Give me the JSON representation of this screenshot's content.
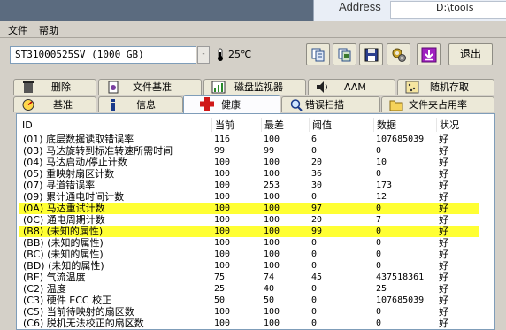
{
  "background_window": {
    "address_label": "Address",
    "path": "D:\\tools"
  },
  "menu": {
    "file": "文件",
    "help": "帮助"
  },
  "toolbar": {
    "drive": "ST31000525SV (1000 GB)",
    "drive_arrow": "-",
    "temperature": "25℃",
    "exit_label": "退出"
  },
  "tabs_top": [
    {
      "label": "删除",
      "icon": "trash-icon"
    },
    {
      "label": "文件基准",
      "icon": "file-benchmark-icon"
    },
    {
      "label": "磁盘监视器",
      "icon": "disk-monitor-icon"
    },
    {
      "label": "AAM",
      "icon": "speaker-icon"
    },
    {
      "label": "随机存取",
      "icon": "random-access-icon"
    }
  ],
  "tabs_bottom": [
    {
      "label": "基准",
      "icon": "benchmark-icon"
    },
    {
      "label": "信息",
      "icon": "info-icon"
    },
    {
      "label": "健康",
      "icon": "health-cross-icon"
    },
    {
      "label": "错误扫描",
      "icon": "error-scan-icon"
    },
    {
      "label": "文件夹占用率",
      "icon": "folder-icon"
    }
  ],
  "columns": [
    "ID",
    "当前",
    "最差",
    "阈值",
    "数据",
    "状况"
  ],
  "rows": [
    {
      "id": "(01) 底层数据读取错误率",
      "cur": "116",
      "wor": "100",
      "thr": "6",
      "dat": "107685039",
      "st": "好",
      "hl": false
    },
    {
      "id": "(03) 马达旋转到标准转速所需时间",
      "cur": "99",
      "wor": "99",
      "thr": "0",
      "dat": "0",
      "st": "好",
      "hl": false
    },
    {
      "id": "(04) 马达启动/停止计数",
      "cur": "100",
      "wor": "100",
      "thr": "20",
      "dat": "10",
      "st": "好",
      "hl": false
    },
    {
      "id": "(05) 重映射扇区计数",
      "cur": "100",
      "wor": "100",
      "thr": "36",
      "dat": "0",
      "st": "好",
      "hl": false
    },
    {
      "id": "(07) 寻道错误率",
      "cur": "100",
      "wor": "253",
      "thr": "30",
      "dat": "173",
      "st": "好",
      "hl": false
    },
    {
      "id": "(09) 累计通电时间计数",
      "cur": "100",
      "wor": "100",
      "thr": "0",
      "dat": "12",
      "st": "好",
      "hl": false
    },
    {
      "id": "(0A) 马达重试计数",
      "cur": "100",
      "wor": "100",
      "thr": "97",
      "dat": "0",
      "st": "好",
      "hl": true
    },
    {
      "id": "(0C) 通电周期计数",
      "cur": "100",
      "wor": "100",
      "thr": "20",
      "dat": "7",
      "st": "好",
      "hl": false
    },
    {
      "id": "(B8) (未知的属性)",
      "cur": "100",
      "wor": "100",
      "thr": "99",
      "dat": "0",
      "st": "好",
      "hl": true
    },
    {
      "id": "(BB) (未知的属性)",
      "cur": "100",
      "wor": "100",
      "thr": "0",
      "dat": "0",
      "st": "好",
      "hl": false
    },
    {
      "id": "(BC) (未知的属性)",
      "cur": "100",
      "wor": "100",
      "thr": "0",
      "dat": "0",
      "st": "好",
      "hl": false
    },
    {
      "id": "(BD) (未知的属性)",
      "cur": "100",
      "wor": "100",
      "thr": "0",
      "dat": "0",
      "st": "好",
      "hl": false
    },
    {
      "id": "(BE) 气流温度",
      "cur": "75",
      "wor": "74",
      "thr": "45",
      "dat": "437518361",
      "st": "好",
      "hl": false
    },
    {
      "id": "(C2) 温度",
      "cur": "25",
      "wor": "40",
      "thr": "0",
      "dat": "25",
      "st": "好",
      "hl": false
    },
    {
      "id": "(C3) 硬件 ECC 校正",
      "cur": "50",
      "wor": "50",
      "thr": "0",
      "dat": "107685039",
      "st": "好",
      "hl": false
    },
    {
      "id": "(C5) 当前待映射的扇区数",
      "cur": "100",
      "wor": "100",
      "thr": "0",
      "dat": "0",
      "st": "好",
      "hl": false
    },
    {
      "id": "(C6) 脱机无法校正的扇区数",
      "cur": "100",
      "wor": "100",
      "thr": "0",
      "dat": "0",
      "st": "好",
      "hl": false
    }
  ],
  "colors": {
    "highlight": "#ffff33",
    "exit_icon": "#a020c0"
  }
}
